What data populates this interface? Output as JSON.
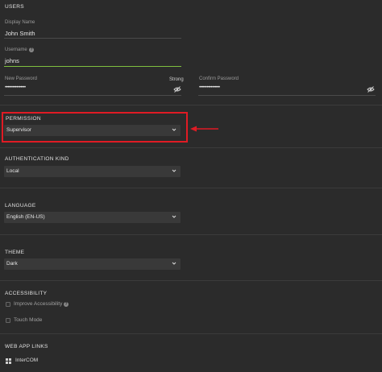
{
  "users": {
    "section_title": "USERS",
    "display_name_label": "Display Name",
    "display_name_value": "John Smith",
    "username_label": "Username",
    "username_value": "johns",
    "new_password_label": "New Password",
    "new_password_value": "••••••••••••••••",
    "strength": "Strong",
    "confirm_password_label": "Confirm Password",
    "confirm_password_value": "••••••••••••••••"
  },
  "permission": {
    "section_title": "PERMISSION",
    "selected": "Supervisor"
  },
  "auth_kind": {
    "section_title": "AUTHENTICATION KIND",
    "selected": "Local"
  },
  "language": {
    "section_title": "LANGUAGE",
    "selected": "English (EN-US)"
  },
  "theme": {
    "section_title": "THEME",
    "selected": "Dark"
  },
  "accessibility": {
    "section_title": "ACCESSIBILITY",
    "improve_label": "Improve Accessibility",
    "touch_label": "Touch Mode"
  },
  "web_app_links": {
    "section_title": "WEB APP LINKS",
    "link_label": "InterCOM",
    "link_icon": "grid-icon"
  },
  "colors": {
    "background": "#2b2b2b",
    "accent_underline": "#7fbf3f",
    "highlight": "#e01b24"
  }
}
